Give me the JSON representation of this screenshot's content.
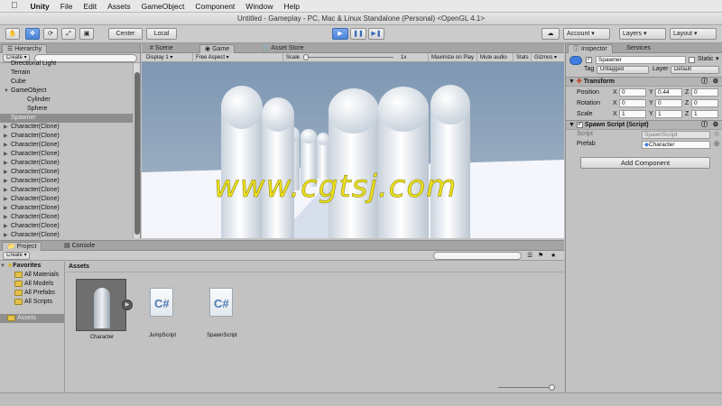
{
  "menubar": {
    "app": "Unity",
    "items": [
      "File",
      "Edit",
      "Assets",
      "GameObject",
      "Component",
      "Window",
      "Help"
    ]
  },
  "window_title": "Untitled - Gameplay - PC, Mac & Linux Standalone (Personal) <OpenGL 4.1>",
  "toolbar": {
    "pivot_label": "Center",
    "space_label": "Local",
    "account_label": "Account",
    "layers_label": "Layers",
    "layout_label": "Layout",
    "play_state": "playing"
  },
  "hierarchy": {
    "tab": "Hierarchy",
    "create_label": "Create",
    "items": [
      {
        "label": "Directional Light",
        "indent": 1,
        "arrow": ""
      },
      {
        "label": "Terrain",
        "indent": 1,
        "arrow": ""
      },
      {
        "label": "Cube",
        "indent": 1,
        "arrow": ""
      },
      {
        "label": "GameObject",
        "indent": 1,
        "arrow": "▼"
      },
      {
        "label": "Cylinder",
        "indent": 2,
        "arrow": ""
      },
      {
        "label": "Sphere",
        "indent": 2,
        "arrow": ""
      },
      {
        "label": "Spawner",
        "indent": 1,
        "arrow": "",
        "selected": true
      },
      {
        "label": "Character(Clone)",
        "indent": 1,
        "arrow": "▶"
      },
      {
        "label": "Character(Clone)",
        "indent": 1,
        "arrow": "▶"
      },
      {
        "label": "Character(Clone)",
        "indent": 1,
        "arrow": "▶"
      },
      {
        "label": "Character(Clone)",
        "indent": 1,
        "arrow": "▶"
      },
      {
        "label": "Character(Clone)",
        "indent": 1,
        "arrow": "▶"
      },
      {
        "label": "Character(Clone)",
        "indent": 1,
        "arrow": "▶"
      },
      {
        "label": "Character(Clone)",
        "indent": 1,
        "arrow": "▶"
      },
      {
        "label": "Character(Clone)",
        "indent": 1,
        "arrow": "▶"
      },
      {
        "label": "Character(Clone)",
        "indent": 1,
        "arrow": "▶"
      },
      {
        "label": "Character(Clone)",
        "indent": 1,
        "arrow": "▶"
      },
      {
        "label": "Character(Clone)",
        "indent": 1,
        "arrow": "▶"
      },
      {
        "label": "Character(Clone)",
        "indent": 1,
        "arrow": "▶"
      },
      {
        "label": "Character(Clone)",
        "indent": 1,
        "arrow": "▶"
      }
    ]
  },
  "center": {
    "tabs": [
      "Scene",
      "Game",
      "Asset Store"
    ],
    "active_tab": "Game",
    "display": "Display 1",
    "aspect": "Free Aspect",
    "scale_label": "Scale",
    "scale_value": "1x",
    "maximize_on_play": "Maximize on Play",
    "mute_audio": "Mute audio",
    "stats": "Stats",
    "gizmos": "Gizmos"
  },
  "watermark": "www.cgtsj.com",
  "inspector": {
    "tabs": [
      "Inspector",
      "Services"
    ],
    "object_name": "Spawner",
    "static_label": "Static",
    "tag_label": "Tag",
    "tag_value": "Untagged",
    "layer_label": "Layer",
    "layer_value": "Default",
    "transform": {
      "title": "Transform",
      "rows": [
        {
          "label": "Position",
          "x": "0",
          "y": "0.44",
          "z": "0"
        },
        {
          "label": "Rotation",
          "x": "0",
          "y": "0",
          "z": "0"
        },
        {
          "label": "Scale",
          "x": "1",
          "y": "1",
          "z": "1"
        }
      ]
    },
    "spawn_script": {
      "title": "Spawn Script (Script)",
      "script_label": "Script",
      "script_value": "SpawnScript",
      "prefab_label": "Prefab",
      "prefab_value": "Character"
    },
    "add_component": "Add Component"
  },
  "bottom": {
    "tabs": [
      "Project",
      "Console"
    ],
    "create_label": "Create",
    "favorites_title": "Favorites",
    "favorites": [
      "All Materials",
      "All Models",
      "All Prefabs",
      "All Scripts"
    ],
    "assets_folder": "Assets",
    "breadcrumb": "Assets",
    "assets": [
      {
        "name": "Character",
        "kind": "prefab"
      },
      {
        "name": "JumpScript",
        "kind": "script"
      },
      {
        "name": "SpawnScript",
        "kind": "script"
      }
    ]
  },
  "icons": {
    "hand": "hand-icon",
    "move": "move-icon",
    "rotate": "rotate-icon",
    "scale": "scale-icon",
    "rect": "rect-tool-icon",
    "play": "play-icon",
    "pause": "pause-icon",
    "step": "step-icon",
    "cloud": "cloud-icon"
  }
}
